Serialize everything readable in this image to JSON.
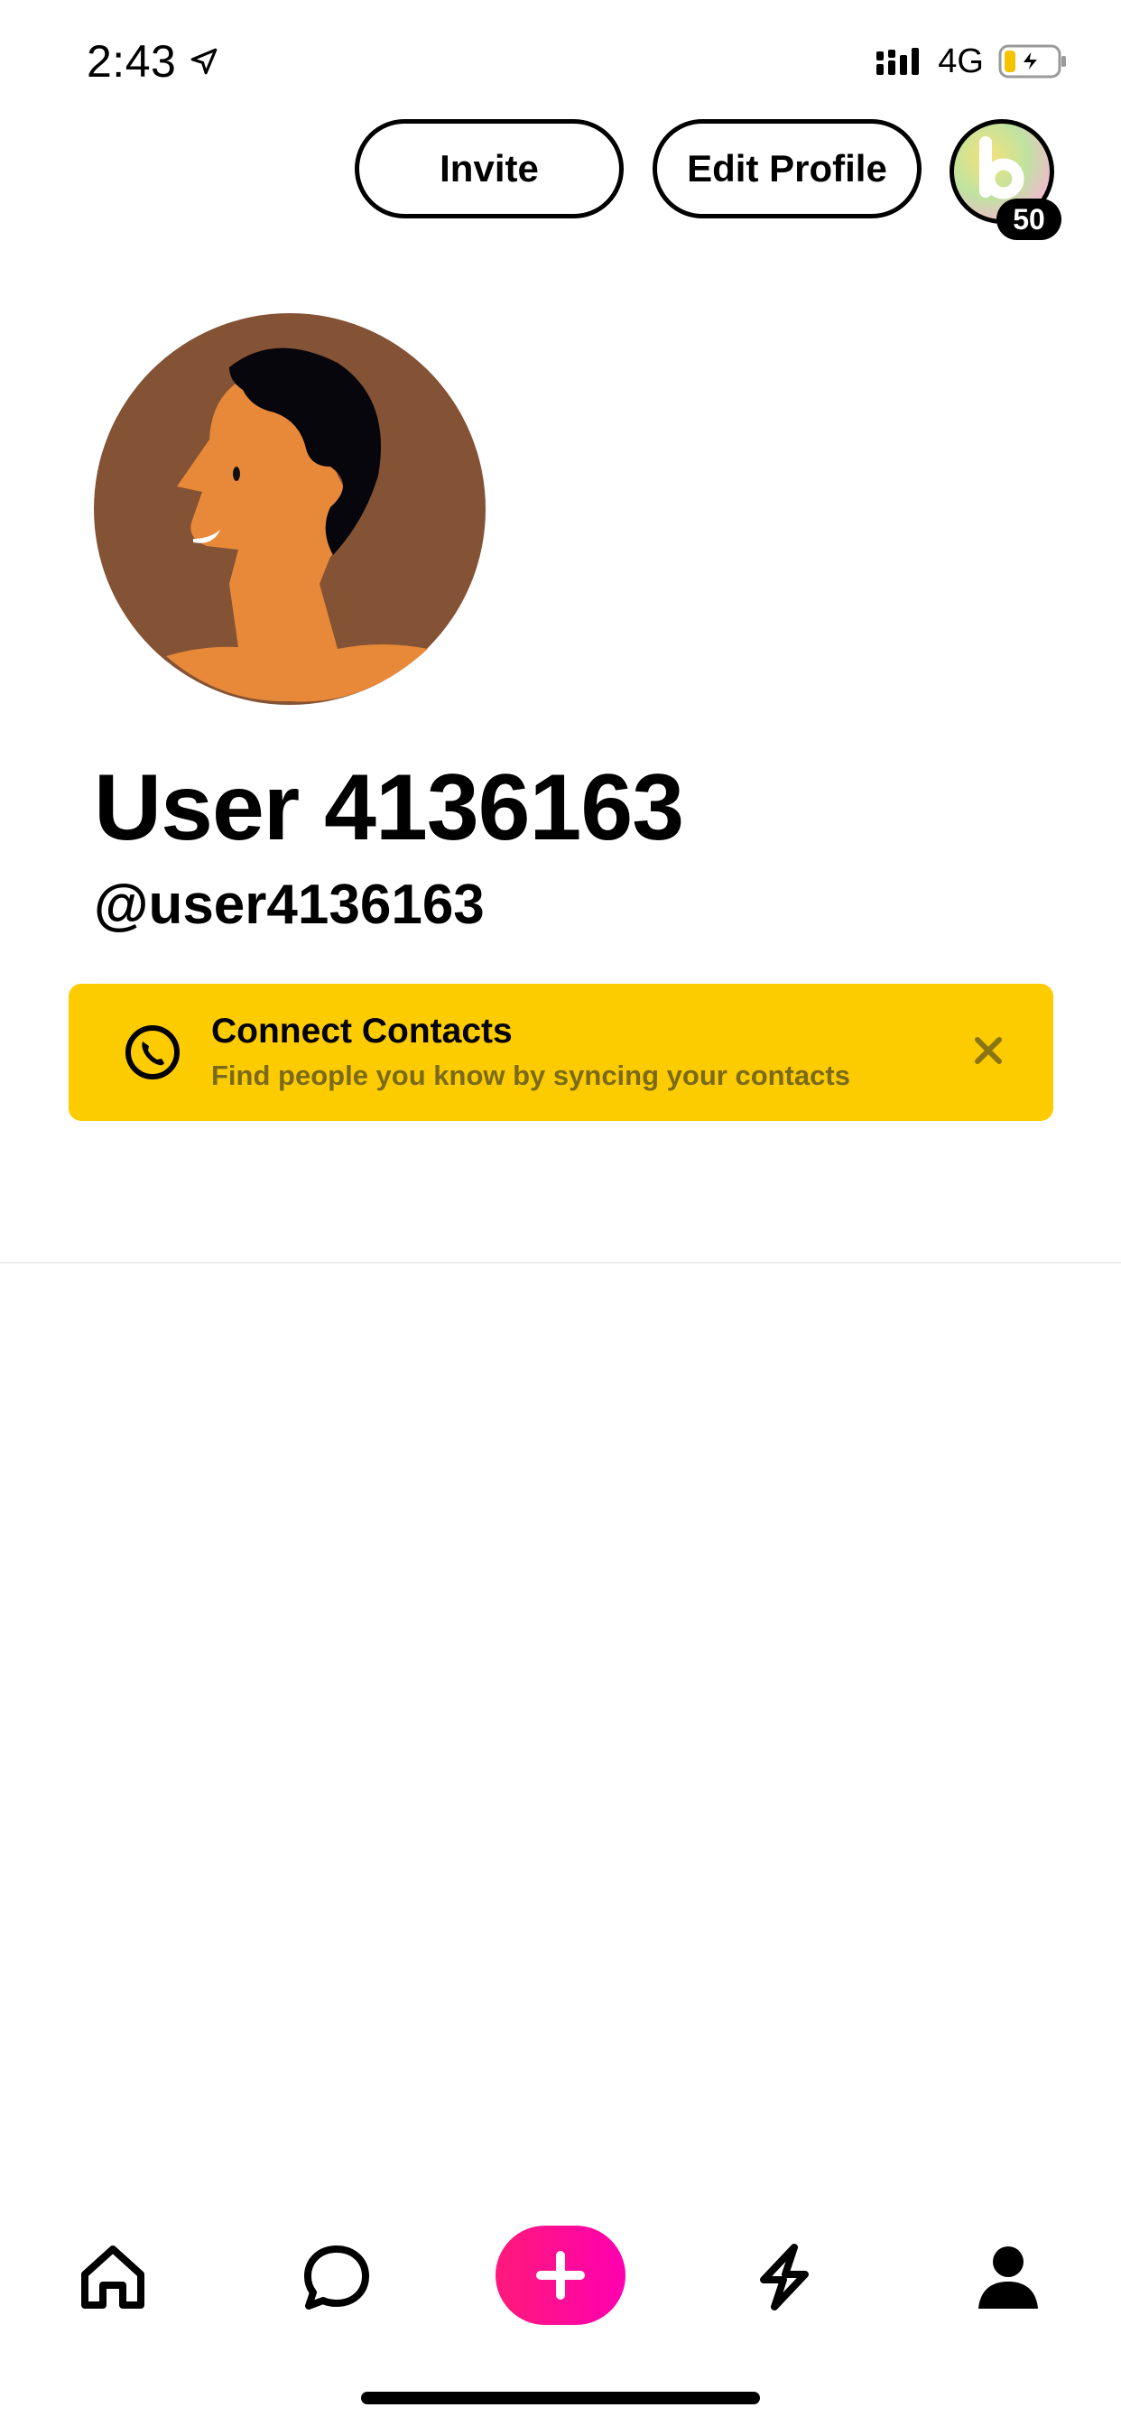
{
  "status_bar": {
    "time": "2:43",
    "network": "4G"
  },
  "header": {
    "invite_label": "Invite",
    "edit_profile_label": "Edit Profile",
    "score": "50",
    "logo_letter": "b"
  },
  "profile": {
    "display_name": "User 4136163",
    "handle": "@user4136163"
  },
  "banner": {
    "title": "Connect Contacts",
    "subtitle": "Find people you know by syncing your contacts"
  },
  "colors": {
    "banner": "#fccc00",
    "accent": "#ff0a8c",
    "avatar_bg": "#845234",
    "skin": "#e8893a"
  },
  "nav": {
    "items": [
      "home-icon",
      "chat-icon",
      "create-icon",
      "activity-icon",
      "profile-icon"
    ]
  }
}
